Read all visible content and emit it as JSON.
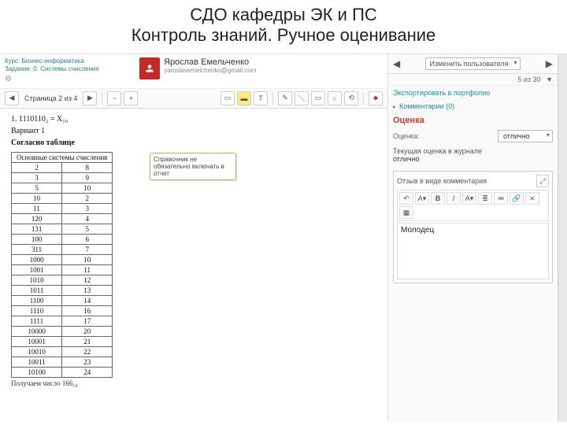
{
  "slide": {
    "title1": "СДО кафедры ЭК и ПС",
    "title2": "Контроль знаний. Ручное оценивание"
  },
  "course": {
    "line1": "Курс: Бизнес-информатика",
    "line2": "Задание: 0. Системы счисления"
  },
  "user": {
    "name": "Ярослав Емельченко",
    "email": "yaroslavemelchenko@gmail.com"
  },
  "pager": {
    "label": "Страница 2 из 4"
  },
  "doc": {
    "q": "1.  1110110₂  =  X₁₀",
    "variant": "Вариант 1",
    "stitle": "Согласно таблице",
    "thead": "Основные системы счисления",
    "rows": [
      [
        "2",
        "8"
      ],
      [
        "3",
        "9"
      ],
      [
        "5",
        "10"
      ],
      [
        "10",
        "2"
      ],
      [
        "11",
        "3"
      ],
      [
        "120",
        "4"
      ],
      [
        "131",
        "5"
      ],
      [
        "100",
        "6"
      ],
      [
        "311",
        "7"
      ],
      [
        "1000",
        "10"
      ],
      [
        "1001",
        "11"
      ],
      [
        "1010",
        "12"
      ],
      [
        "1011",
        "13"
      ],
      [
        "1100",
        "14"
      ],
      [
        "1110",
        "16"
      ],
      [
        "1111",
        "17"
      ],
      [
        "10000",
        "20"
      ],
      [
        "10001",
        "21"
      ],
      [
        "10010",
        "22"
      ],
      [
        "10011",
        "23"
      ],
      [
        "10100",
        "24"
      ]
    ],
    "tail": "Получаем число 166₁₀",
    "note": "Справочник не обязательно включать в отчет"
  },
  "right": {
    "changeUser": "Изменить пользователя",
    "counter": "5 из 30",
    "export": "Экспортировать в портфолио",
    "comments": "Комментарии (0)",
    "gradeLabel": "Оценка",
    "gradeKey": "Оценка:",
    "gradeValue": "отлично",
    "currentLabel": "Текущая оценка в журнале",
    "currentValue": "отлично",
    "feedbackLabel": "Отзыв в виде комментария",
    "feedbackText": "Молодец"
  }
}
